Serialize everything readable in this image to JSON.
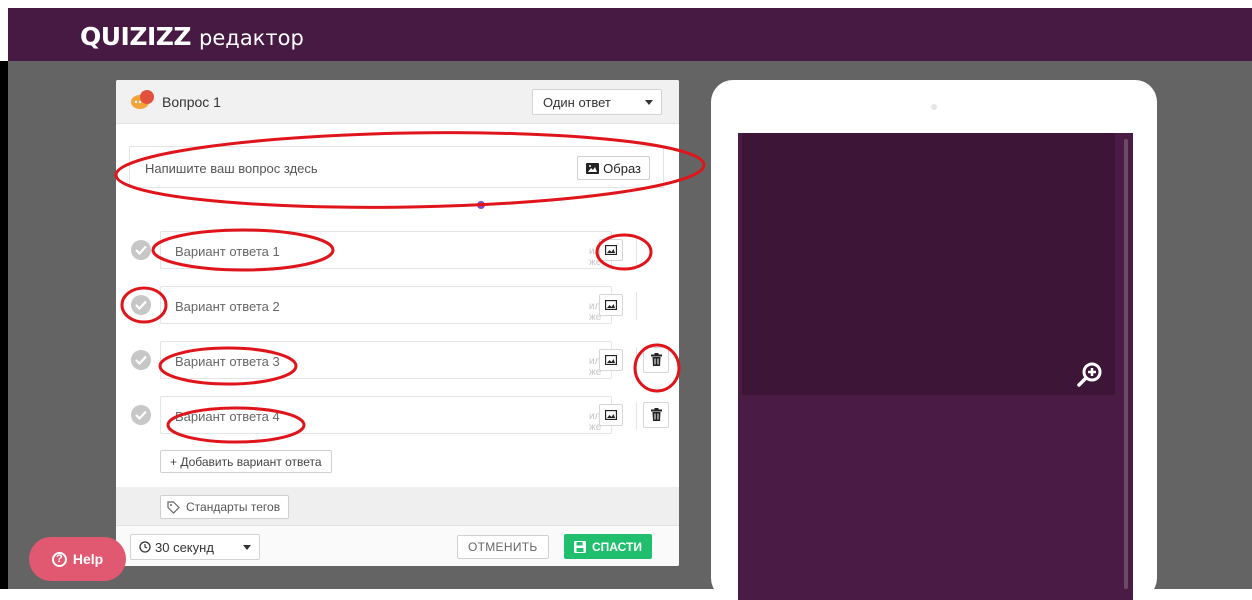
{
  "app": {
    "logo_word": "QUIZIZZ",
    "logo_sub": "редактор"
  },
  "question": {
    "title": "Вопрос 1",
    "type_select": "Один ответ",
    "text_placeholder": "Напишите ваш вопрос здесь",
    "image_button": "Образ"
  },
  "answers": [
    {
      "placeholder": "Вариант ответа 1",
      "or_text": "или же",
      "has_delete": false
    },
    {
      "placeholder": "Вариант ответа 2",
      "or_text": "или же",
      "has_delete": false
    },
    {
      "placeholder": "Вариант ответа 3",
      "or_text": "или же",
      "has_delete": true
    },
    {
      "placeholder": "Вариант ответа 4",
      "or_text": "или же",
      "has_delete": true
    }
  ],
  "add_option_label": "+ Добавить вариант ответа",
  "tags_label": "Стандарты тегов",
  "footer": {
    "time_select": "30 секунд",
    "cancel_label": "ОТМЕНИТЬ",
    "save_label": "СПАСТИ"
  },
  "help_label": "Help",
  "colors": {
    "brand": "#461a42",
    "save_green": "#1fbf6e",
    "help_pink": "#e05970",
    "annotation_red": "#e0151b"
  }
}
